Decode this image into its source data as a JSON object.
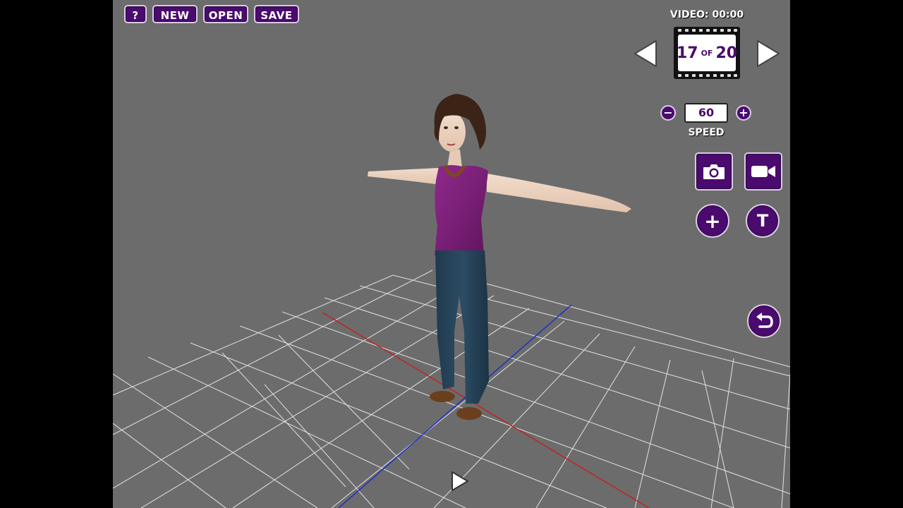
{
  "toolbar": {
    "help_label": "?",
    "new_label": "NEW",
    "open_label": "OPEN",
    "save_label": "SAVE"
  },
  "video": {
    "label": "VIDEO: 00:00",
    "frame_current": "17",
    "frame_of": "OF",
    "frame_total": "20"
  },
  "speed": {
    "value": "60",
    "label": "SPEED",
    "minus": "−",
    "plus": "+"
  },
  "side_buttons": {
    "add": "+",
    "text": "T"
  },
  "icons": {
    "prev": "prev-frame-icon",
    "next": "next-frame-icon",
    "camera": "camera-icon",
    "video": "video-camera-icon",
    "undo": "undo-icon",
    "play": "play-icon"
  },
  "colors": {
    "accent": "#4a0a6e",
    "border": "#d8cde3",
    "viewport": "#6c6c6c",
    "grid": "#d9d9d9",
    "axis_x": "#c81e1e",
    "axis_z": "#1e2ad0"
  }
}
